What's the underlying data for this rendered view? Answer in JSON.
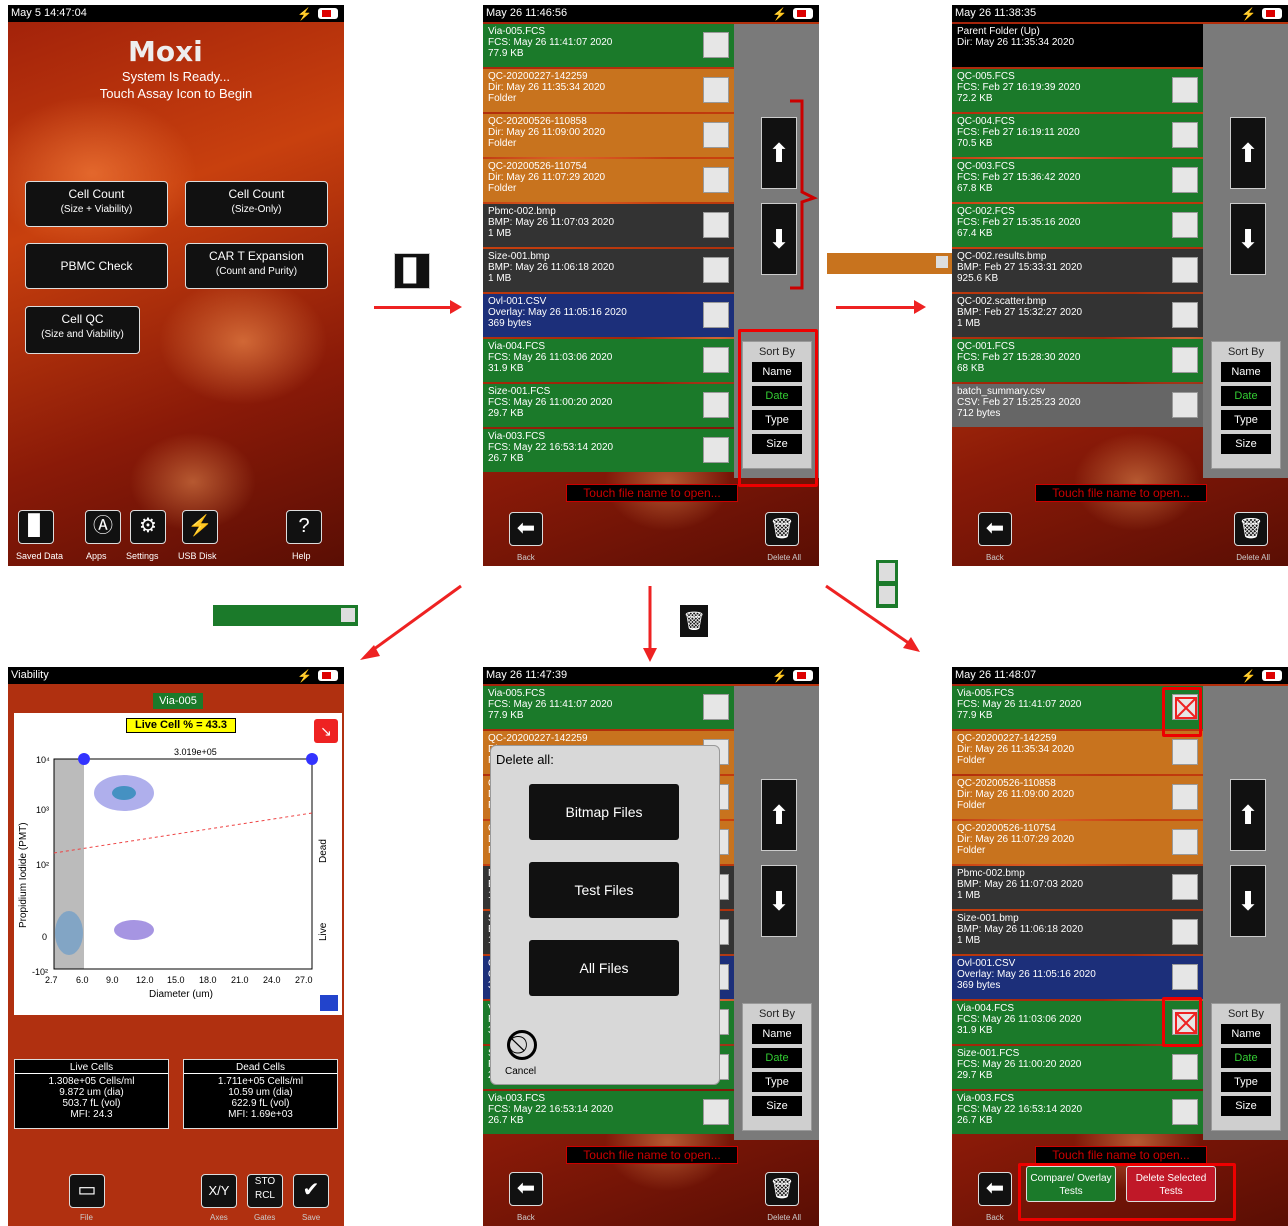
{
  "panel1": {
    "status_time": "May  5 14:47:04",
    "logo": "Moxi",
    "ready_line1": "System Is Ready...",
    "ready_line2": "Touch Assay Icon to Begin",
    "assays": [
      {
        "title": "Cell Count",
        "sub": "(Size + Viability)"
      },
      {
        "title": "Cell Count",
        "sub": "(Size-Only)"
      },
      {
        "title": "PBMC Check",
        "sub": ""
      },
      {
        "title": "CAR T Expansion",
        "sub": "(Count and Purity)"
      },
      {
        "title": "Cell QC",
        "sub": "(Size and Viability)"
      }
    ],
    "bottom": {
      "saved": "Saved Data",
      "apps": "Apps",
      "settings": "Settings",
      "usb": "USB Disk",
      "help": "Help"
    }
  },
  "panel2": {
    "status_time": "May 26 11:46:56",
    "files": [
      {
        "name": "Via-005.FCS",
        "meta": "FCS: May 26 11:41:07 2020",
        "size": "77.9 KB",
        "color": "green"
      },
      {
        "name": "QC-20200227-142259",
        "meta": "Dir: May 26 11:35:34 2020",
        "size": "Folder",
        "color": "orange"
      },
      {
        "name": "QC-20200526-110858",
        "meta": "Dir: May 26 11:09:00 2020",
        "size": "Folder",
        "color": "orange"
      },
      {
        "name": "QC-20200526-110754",
        "meta": "Dir: May 26 11:07:29 2020",
        "size": "Folder",
        "color": "orange"
      },
      {
        "name": "Pbmc-002.bmp",
        "meta": "BMP: May 26 11:07:03 2020",
        "size": "1 MB",
        "color": "dark"
      },
      {
        "name": "Size-001.bmp",
        "meta": "BMP: May 26 11:06:18 2020",
        "size": "1 MB",
        "color": "dark"
      },
      {
        "name": "Ovl-001.CSV",
        "meta": "Overlay: May 26 11:05:16 2020",
        "size": "369 bytes",
        "color": "blue"
      },
      {
        "name": "Via-004.FCS",
        "meta": "FCS: May 26 11:03:06 2020",
        "size": "31.9 KB",
        "color": "green"
      },
      {
        "name": "Size-001.FCS",
        "meta": "FCS: May 26 11:00:20 2020",
        "size": "29.7 KB",
        "color": "green"
      },
      {
        "name": "Via-003.FCS",
        "meta": "FCS: May 22 16:53:14 2020",
        "size": "26.7 KB",
        "color": "green"
      }
    ],
    "sort_title": "Sort By",
    "sort": [
      "Name",
      "Date",
      "Type",
      "Size"
    ],
    "touch_hint": "Touch file name to open...",
    "back": "Back",
    "delete_all": "Delete All"
  },
  "panel3": {
    "status_time": "May 26 11:38:35",
    "files": [
      {
        "name": "Parent Folder (Up)",
        "meta": "Dir: May 26 11:35:34 2020",
        "size": "",
        "color": "black"
      },
      {
        "name": "QC-005.FCS",
        "meta": "FCS: Feb 27 16:19:39 2020",
        "size": "72.2 KB",
        "color": "green"
      },
      {
        "name": "QC-004.FCS",
        "meta": "FCS: Feb 27 16:19:11 2020",
        "size": "70.5 KB",
        "color": "green"
      },
      {
        "name": "QC-003.FCS",
        "meta": "FCS: Feb 27 15:36:42 2020",
        "size": "67.8 KB",
        "color": "green"
      },
      {
        "name": "QC-002.FCS",
        "meta": "FCS: Feb 27 15:35:16 2020",
        "size": "67.4 KB",
        "color": "green"
      },
      {
        "name": "QC-002.results.bmp",
        "meta": "BMP: Feb 27 15:33:31 2020",
        "size": "925.6 KB",
        "color": "dark"
      },
      {
        "name": "QC-002.scatter.bmp",
        "meta": "BMP: Feb 27 15:32:27 2020",
        "size": "1 MB",
        "color": "dark"
      },
      {
        "name": "QC-001.FCS",
        "meta": "FCS: Feb 27 15:28:30 2020",
        "size": "68 KB",
        "color": "green"
      },
      {
        "name": "batch_summary.csv",
        "meta": "CSV: Feb 27 15:25:23 2020",
        "size": "712 bytes",
        "color": "gray"
      }
    ]
  },
  "panel4": {
    "title": "Viability",
    "sample": "Via-005",
    "live_pct": "Live Cell % = 43.3",
    "gate_value": "3.019e+05",
    "ylabel": "Propidium Iodide (PMT)",
    "xlabel": "Diameter (um)",
    "dead": "Dead",
    "live": "Live",
    "xticks": [
      "2.7",
      "6.0",
      "9.0",
      "12.0",
      "15.0",
      "18.0",
      "21.0",
      "24.0",
      "27.0"
    ],
    "yticks": [
      "10⁴",
      "10³",
      "10²",
      "0",
      "-10²"
    ],
    "live_cells": {
      "title": "Live Cells",
      "l1": "1.308e+05 Cells/ml",
      "l2": "9.872 um (dia)",
      "l3": "503.7 fL (vol)",
      "l4": "MFI: 24.3"
    },
    "dead_cells": {
      "title": "Dead Cells",
      "l1": "1.711e+05 Cells/ml",
      "l2": "10.59 um (dia)",
      "l3": "622.9 fL (vol)",
      "l4": "MFI: 1.69e+03"
    },
    "bottom": {
      "file": "File",
      "axes": "Axes",
      "gates": "Gates",
      "save": "Save"
    }
  },
  "panel5": {
    "status_time": "May 26 11:47:39",
    "dialog_title": "Delete all:",
    "bitmap": "Bitmap Files",
    "test": "Test Files",
    "all": "All Files",
    "cancel": "Cancel"
  },
  "panel6": {
    "status_time": "May 26 11:48:07",
    "compare": "Compare/ Overlay Tests",
    "delete_selected": "Delete Selected Tests"
  },
  "colors": {
    "arrow": "#e22222",
    "highlight": "#ee0000"
  }
}
